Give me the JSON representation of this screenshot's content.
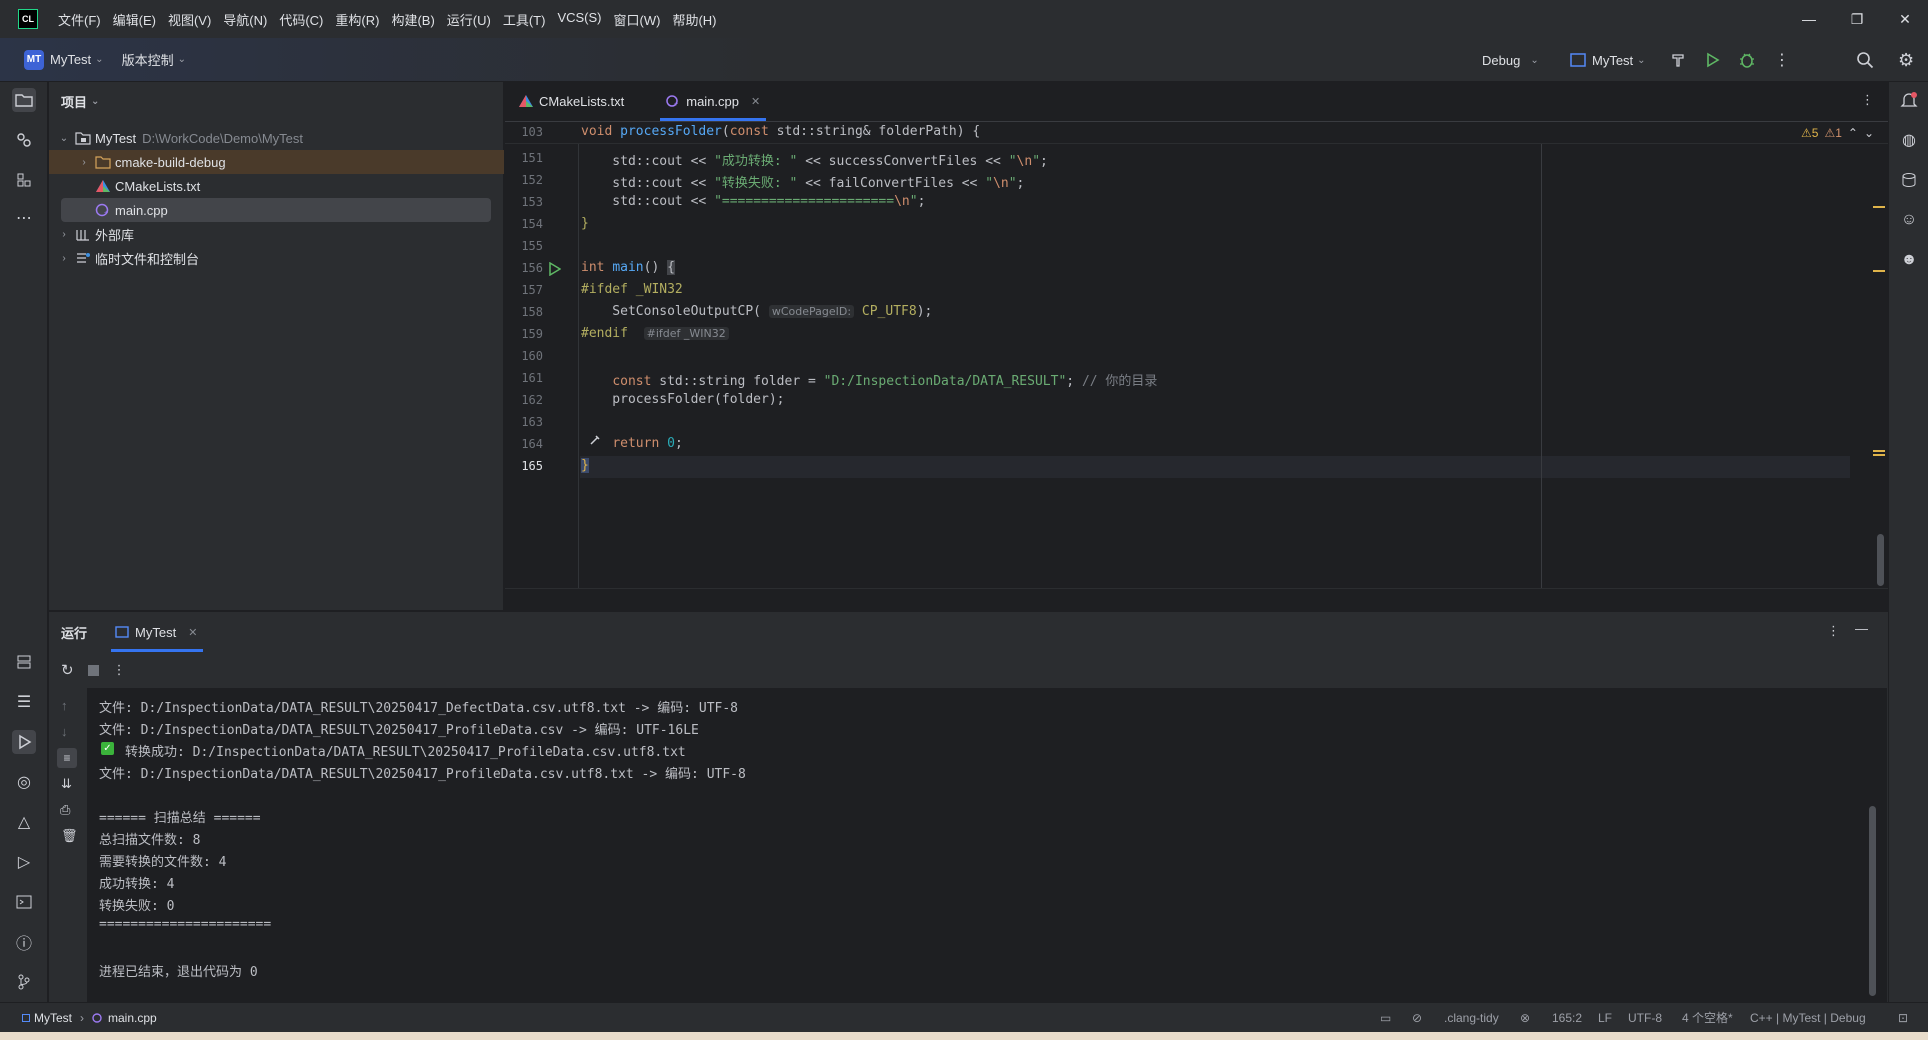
{
  "titlebar": {
    "logo": "CL",
    "menu": [
      "文件(F)",
      "编辑(E)",
      "视图(V)",
      "导航(N)",
      "代码(C)",
      "重构(R)",
      "构建(B)",
      "运行(U)",
      "工具(T)",
      "VCS(S)",
      "窗口(W)",
      "帮助(H)"
    ],
    "minimize": "—",
    "restore": "❐",
    "close": "✕"
  },
  "toolbar": {
    "project_badge": "MT",
    "project_name": "MyTest",
    "vcs_label": "版本控制",
    "config": "Debug",
    "run_target": "MyTest"
  },
  "project": {
    "title": "项目",
    "root_name": "MyTest",
    "root_path": "D:\\WorkCode\\Demo\\MyTest",
    "items": [
      "cmake-build-debug",
      "CMakeLists.txt",
      "main.cpp",
      "外部库",
      "临时文件和控制台"
    ]
  },
  "editor": {
    "tabs": [
      "CMakeLists.txt",
      "main.cpp"
    ],
    "warnings": "⚠5",
    "weak_warnings": "⚠1",
    "sticky_line": "103",
    "line_numbers": [
      "151",
      "152",
      "153",
      "154",
      "155",
      "156",
      "157",
      "158",
      "159",
      "160",
      "161",
      "162",
      "163",
      "164",
      "165"
    ],
    "inlay_param": "wCodePageID:",
    "inlay_endif": "#ifdef _WIN32"
  },
  "run": {
    "title": "运行",
    "tab": "MyTest",
    "console_lines": [
      "文件: D:/InspectionData/DATA_RESULT\\20250417_DefectData.csv.utf8.txt -> 编码: UTF-8",
      "文件: D:/InspectionData/DATA_RESULT\\20250417_ProfileData.csv -> 编码: UTF-16LE",
      "转换成功: D:/InspectionData/DATA_RESULT\\20250417_ProfileData.csv.utf8.txt",
      "文件: D:/InspectionData/DATA_RESULT\\20250417_ProfileData.csv.utf8.txt -> 编码: UTF-8",
      "",
      "====== 扫描总结 ======",
      "总扫描文件数: 8",
      "需要转换的文件数: 4",
      "成功转换: 4",
      "转换失败: 0",
      "======================",
      "",
      "进程已结束，退出代码为 0"
    ]
  },
  "status": {
    "project": "MyTest",
    "file": "main.cpp",
    "inspector": ".clang-tidy",
    "position": "165:2",
    "line_sep": "LF",
    "encoding": "UTF-8",
    "indent": "4 个空格*",
    "context": "C++ | MyTest | Debug"
  }
}
